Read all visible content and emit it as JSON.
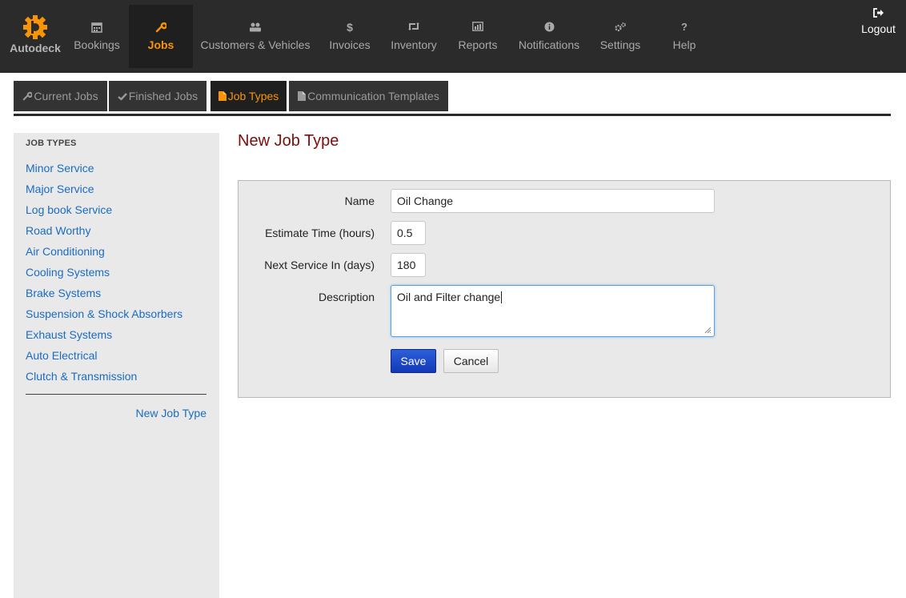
{
  "brand": {
    "name": "Autodeck",
    "icon": "gear-logo-icon",
    "color": "#f89406"
  },
  "nav": {
    "items": [
      {
        "label": "Bookings",
        "icon": "calendar-icon"
      },
      {
        "label": "Jobs",
        "icon": "wrench-icon",
        "active": true
      },
      {
        "label": "Customers & Vehicles",
        "icon": "users-icon"
      },
      {
        "label": "Invoices",
        "icon": "dollar-icon"
      },
      {
        "label": "Inventory",
        "icon": "retweet-icon"
      },
      {
        "label": "Reports",
        "icon": "chart-icon"
      },
      {
        "label": "Notifications",
        "icon": "info-icon"
      },
      {
        "label": "Settings",
        "icon": "cogs-icon"
      },
      {
        "label": "Help",
        "icon": "question-icon"
      }
    ],
    "logout": {
      "label": "Logout",
      "icon": "signout-icon"
    }
  },
  "subtabs": [
    {
      "label": "Current Jobs",
      "icon": "wrench-icon"
    },
    {
      "label": "Finished Jobs",
      "icon": "check-icon"
    },
    {
      "label": "Job Types",
      "icon": "file-icon",
      "active": true
    },
    {
      "label": "Communication Templates",
      "icon": "file-icon"
    }
  ],
  "sidebar": {
    "header": "JOB TYPES",
    "items": [
      "Minor Service",
      "Major Service",
      "Log book Service",
      "Road Worthy",
      "Air Conditioning",
      "Cooling Systems",
      "Brake Systems",
      "Suspension & Shock Absorbers",
      "Exhaust Systems",
      "Auto Electrical",
      "Clutch & Transmission"
    ],
    "new_link": "New Job Type"
  },
  "main": {
    "title": "New Job Type",
    "form": {
      "name_label": "Name",
      "name_value": "Oil Change",
      "estimate_label": "Estimate Time (hours)",
      "estimate_value": "0.5",
      "next_service_label": "Next Service In (days)",
      "next_service_value": "180",
      "description_label": "Description",
      "description_value": "Oil and Filter change",
      "save_label": "Save",
      "cancel_label": "Cancel"
    }
  },
  "colors": {
    "accent": "#f89406",
    "link": "#1a6cc4",
    "title": "#7a0e0e",
    "primary_button": "#1a44c8"
  }
}
